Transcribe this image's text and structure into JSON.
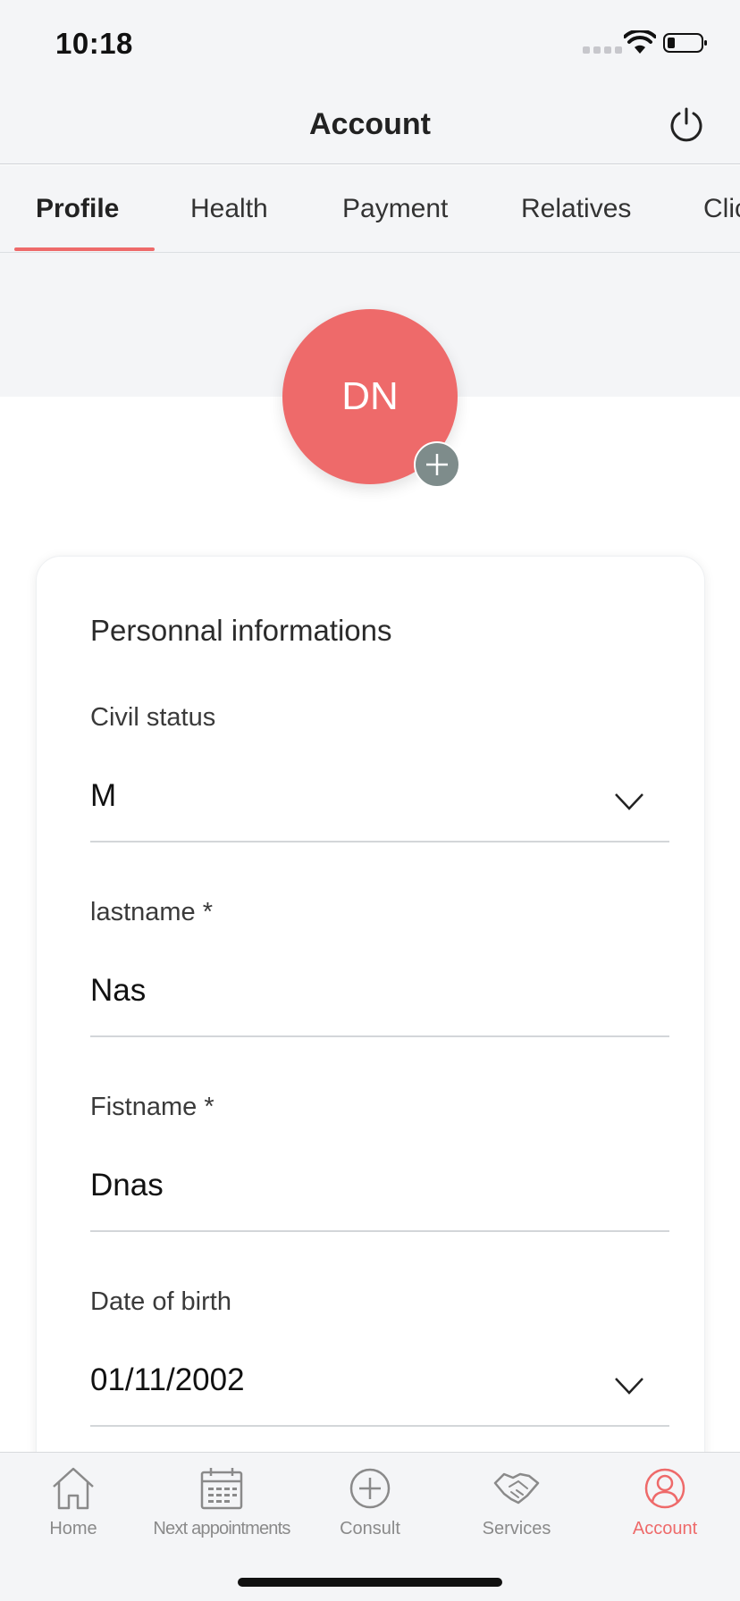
{
  "status_bar": {
    "time": "10:18"
  },
  "header": {
    "title": "Account"
  },
  "tabs": [
    {
      "label": "Profile",
      "active": true
    },
    {
      "label": "Health",
      "active": false
    },
    {
      "label": "Payment",
      "active": false
    },
    {
      "label": "Relatives",
      "active": false
    },
    {
      "label": "Clic",
      "active": false
    }
  ],
  "profile": {
    "initials": "DN"
  },
  "card": {
    "title": "Personnal informations",
    "fields": [
      {
        "label": "Civil status",
        "value": "M",
        "type": "select"
      },
      {
        "label": "lastname *",
        "value": "Nas",
        "type": "text"
      },
      {
        "label": "Fistname *",
        "value": "Dnas",
        "type": "text"
      },
      {
        "label": "Date of birth",
        "value": "01/11/2002",
        "type": "select"
      }
    ]
  },
  "tabbar": {
    "items": [
      {
        "label": "Home",
        "icon": "home-icon",
        "active": false
      },
      {
        "label": "Next appointments",
        "icon": "calendar-icon",
        "active": false
      },
      {
        "label": "Consult",
        "icon": "plus-circle-icon",
        "active": false
      },
      {
        "label": "Services",
        "icon": "handshake-icon",
        "active": false
      },
      {
        "label": "Account",
        "icon": "user-circle-icon",
        "active": true
      }
    ]
  },
  "colors": {
    "accent": "#ee6a6a",
    "background": "#f4f5f7",
    "add_button": "#7e8c8b"
  }
}
